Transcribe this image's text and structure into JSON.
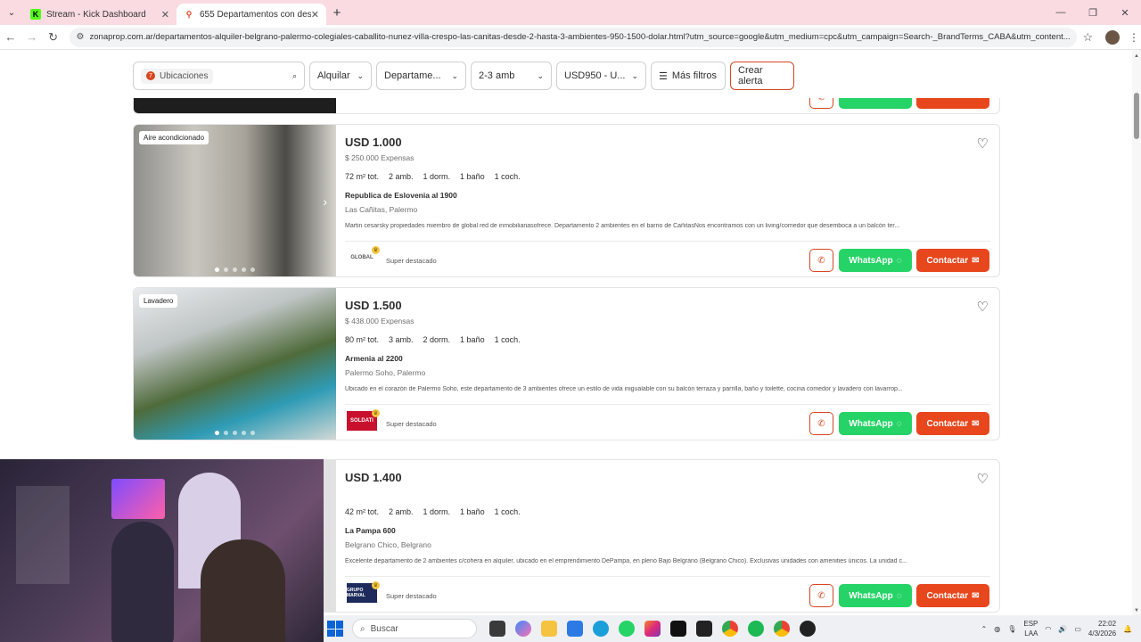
{
  "browser": {
    "tabs": [
      {
        "title": "Stream - Kick Dashboard",
        "active": false,
        "favicon": "kick-icon",
        "favicon_color": "#53fc18"
      },
      {
        "title": "655 Departamentos con desde",
        "active": true,
        "favicon": "zonaprop-icon",
        "favicon_color": "#d6461f"
      }
    ],
    "url": "zonaprop.com.ar/departamentos-alquiler-belgrano-palermo-colegiales-caballito-nunez-villa-crespo-las-canitas-desde-2-hasta-3-ambientes-950-1500-dolar.html?utm_source=google&utm_medium=cpc&utm_campaign=Search-_BrandTerms_CABA&utm_content..."
  },
  "filters": {
    "location_chip_count": "7",
    "location_chip_label": "Ubicaciones",
    "operation": "Alquilar",
    "property_type": "Departame...",
    "rooms": "2-3 amb",
    "price": "USD950 - U...",
    "more": "Más filtros",
    "alert": "Crear alerta"
  },
  "colors": {
    "brand": "#e8461c",
    "whatsapp": "#25d366"
  },
  "listings": [
    {
      "badge": "Aire acondicionado",
      "price": "USD 1.000",
      "expenses": "$ 250.000 Expensas",
      "features": [
        "72 m² tot.",
        "2 amb.",
        "1 dorm.",
        "1 baño",
        "1 coch."
      ],
      "address": "Republica de Eslovenia al 1900",
      "neighborhood": "Las Cañitas, Palermo",
      "description": "Martin cesarsky propiedades miembro de global red de inmobiliariasofrece. Departamento 2 ambientes en el barrio de CañitasNos encontramos con un living/comedor que desemboca a un balcón ter...",
      "agency_logo_text": "GLOBAL",
      "tier": "Super destacado",
      "whatsapp": "WhatsApp",
      "contact": "Contactar"
    },
    {
      "badge": "Lavadero",
      "price": "USD 1.500",
      "expenses": "$ 438.000 Expensas",
      "features": [
        "80 m² tot.",
        "3 amb.",
        "2 dorm.",
        "1 baño",
        "1 coch."
      ],
      "address": "Armenia al 2200",
      "neighborhood": "Palermo Soho, Palermo",
      "description": "Ubicado en el corazón de Palermo Soho, este departamento de 3 ambientes ofrece un estilo de vida inigualable con su balcón terraza y parrilla, baño y toilette, cocina comedor y lavadero con lavarrop...",
      "agency_logo_text": "SOLDATI",
      "tier": "Super destacado",
      "whatsapp": "WhatsApp",
      "contact": "Contactar"
    },
    {
      "badge": "",
      "price": "USD 1.400",
      "expenses": "",
      "features": [
        "42 m² tot.",
        "2 amb.",
        "1 dorm.",
        "1 baño",
        "1 coch."
      ],
      "address": "La Pampa 600",
      "neighborhood": "Belgrano Chico, Belgrano",
      "description": "Excelente departamento de 2 ambientes c/cohera en alquiler, ubicado en el emprendimiento DePampa, en pleno Bajo Belgrano (Belgrano Chico). Exclusivas unidades con amenities únicos. La unidad c...",
      "agency_logo_text": "GRUPO MARVAL",
      "tier": "Super destacado",
      "whatsapp": "WhatsApp",
      "contact": "Contactar"
    }
  ],
  "taskbar": {
    "search_placeholder": "Buscar",
    "lang": "ESP",
    "lang2": "LAA",
    "time": "22:02",
    "date": "4/3/2026"
  }
}
